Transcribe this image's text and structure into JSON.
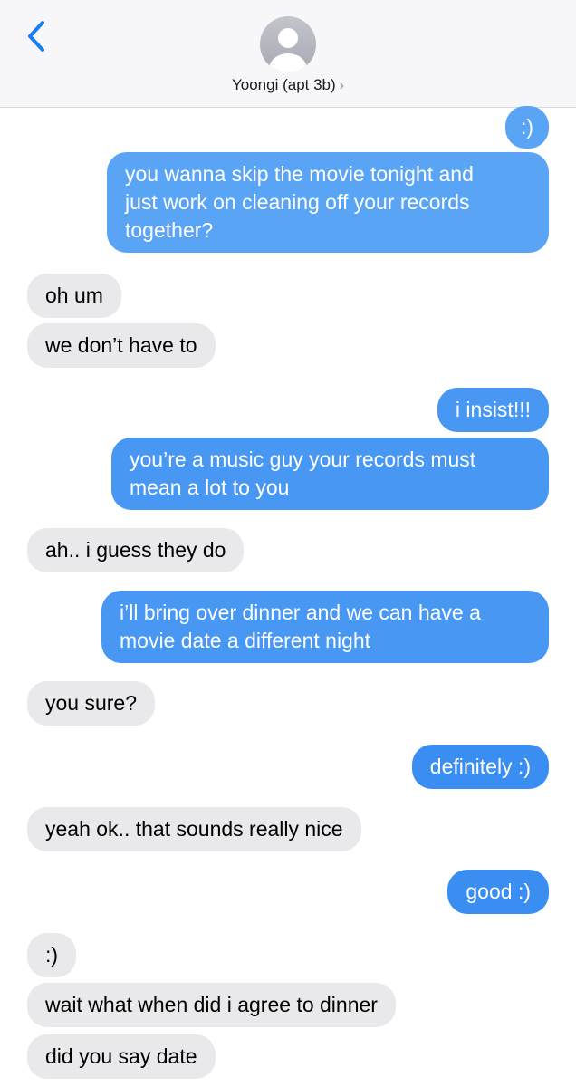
{
  "header": {
    "back_label": "Back",
    "contact_name": "Yoongi (apt 3b)",
    "contact_chevron": "›",
    "back_icon": "chevron-left-icon",
    "avatar_icon": "person-icon"
  },
  "colors": {
    "sent_light": "#5aa4f5",
    "sent_mid": "#4898f3",
    "sent_dark": "#3a8ef2",
    "received": "#e9e9eb",
    "accent": "#1b7cf2"
  },
  "messages": [
    {
      "from": "me",
      "text": ":)"
    },
    {
      "from": "me",
      "text": "you wanna skip the movie tonight and\njust work on cleaning off your records\ntogether?"
    },
    {
      "from": "them",
      "text": "oh um"
    },
    {
      "from": "them",
      "text": "we don’t have to"
    },
    {
      "from": "me",
      "text": "i insist!!!"
    },
    {
      "from": "me",
      "text": "you’re a music guy your records must\nmean a lot to you"
    },
    {
      "from": "them",
      "text": "ah.. i guess they do"
    },
    {
      "from": "me",
      "text": "i’ll bring over dinner and we can have a\nmovie date a different night"
    },
    {
      "from": "them",
      "text": "you sure?"
    },
    {
      "from": "me",
      "text": "definitely :)"
    },
    {
      "from": "them",
      "text": "yeah ok.. that sounds really nice"
    },
    {
      "from": "me",
      "text": "good :)"
    },
    {
      "from": "them",
      "text": ":)"
    },
    {
      "from": "them",
      "text": "wait what when did i agree to dinner"
    },
    {
      "from": "them",
      "text": "did you say date"
    }
  ]
}
